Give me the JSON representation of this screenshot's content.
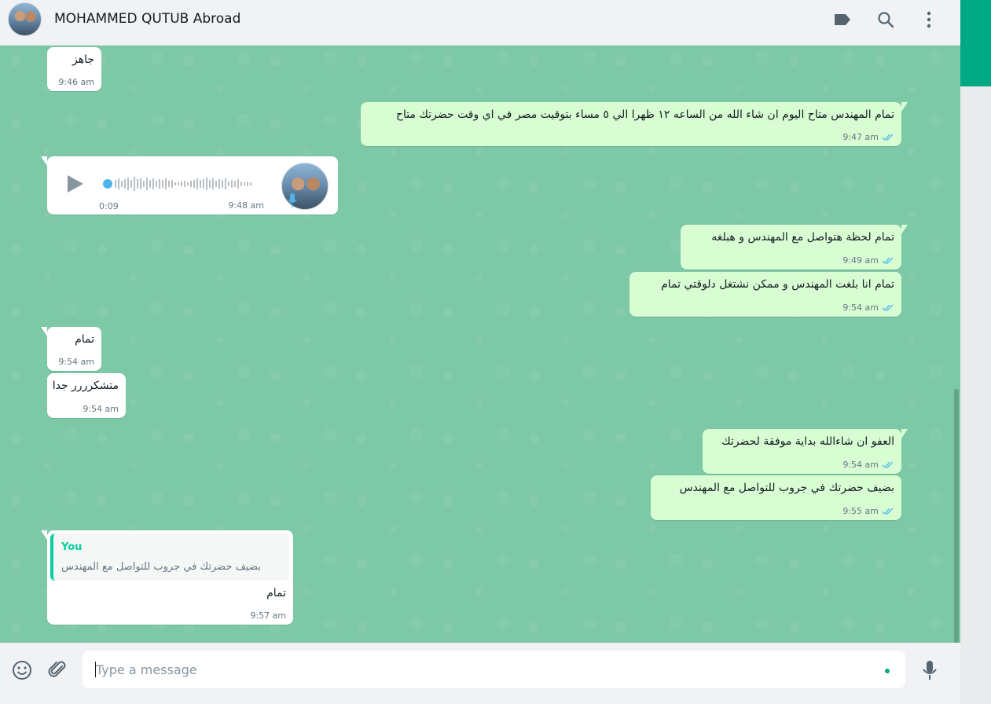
{
  "header": {
    "contact_name": "MOHAMMED QUTUB Abroad",
    "icons": [
      "label-icon",
      "search-icon",
      "menu-icon"
    ]
  },
  "messages": [
    {
      "dir": "in",
      "text": "جاهز",
      "time": "9:46 am"
    },
    {
      "dir": "out",
      "text": "تمام المهندس متاح اليوم ان شاء الله من الساعه ١٢ ظهرا الي ٥ مساء بتوقيت مصر في اي وقت حضرتك متاح",
      "time": "9:47 am",
      "read": true
    },
    {
      "dir": "in",
      "type": "voice",
      "duration": "0:09",
      "time": "9:48 am"
    },
    {
      "dir": "out",
      "text": "تمام لحظة هتواصل مع المهندس و هبلغه",
      "time": "9:49 am",
      "read": true
    },
    {
      "dir": "out",
      "text": "تمام انا بلغت المهندس و ممكن نشتغل دلوقتي تمام",
      "time": "9:54 am",
      "read": true
    },
    {
      "dir": "in",
      "text": "تمام",
      "time": "9:54 am"
    },
    {
      "dir": "in",
      "text": "متشكرررر جدا",
      "time": "9:54 am"
    },
    {
      "dir": "out",
      "text": "العفو ان شاءالله بداية موفقة لحضرتك",
      "time": "9:54 am",
      "read": true
    },
    {
      "dir": "out",
      "text": "بضيف حضرتك في جروب للتواصل مع المهندس",
      "time": "9:55 am",
      "read": true
    },
    {
      "dir": "in",
      "type": "reply",
      "quote_author": "You",
      "quote_text": "بضيف حضرتك في جروب للتواصل مع المهندس",
      "text": "تمام",
      "time": "9:57 am"
    }
  ],
  "composer": {
    "placeholder": "Type a message",
    "icons": [
      "emoji-icon",
      "attach-icon",
      "microphone-icon"
    ]
  },
  "colors": {
    "chat_bg": "#7dc8a6",
    "outgoing_bubble": "#d9fdd3",
    "incoming_bubble": "#ffffff",
    "accent": "#00a884",
    "read_tick": "#53bdeb"
  }
}
